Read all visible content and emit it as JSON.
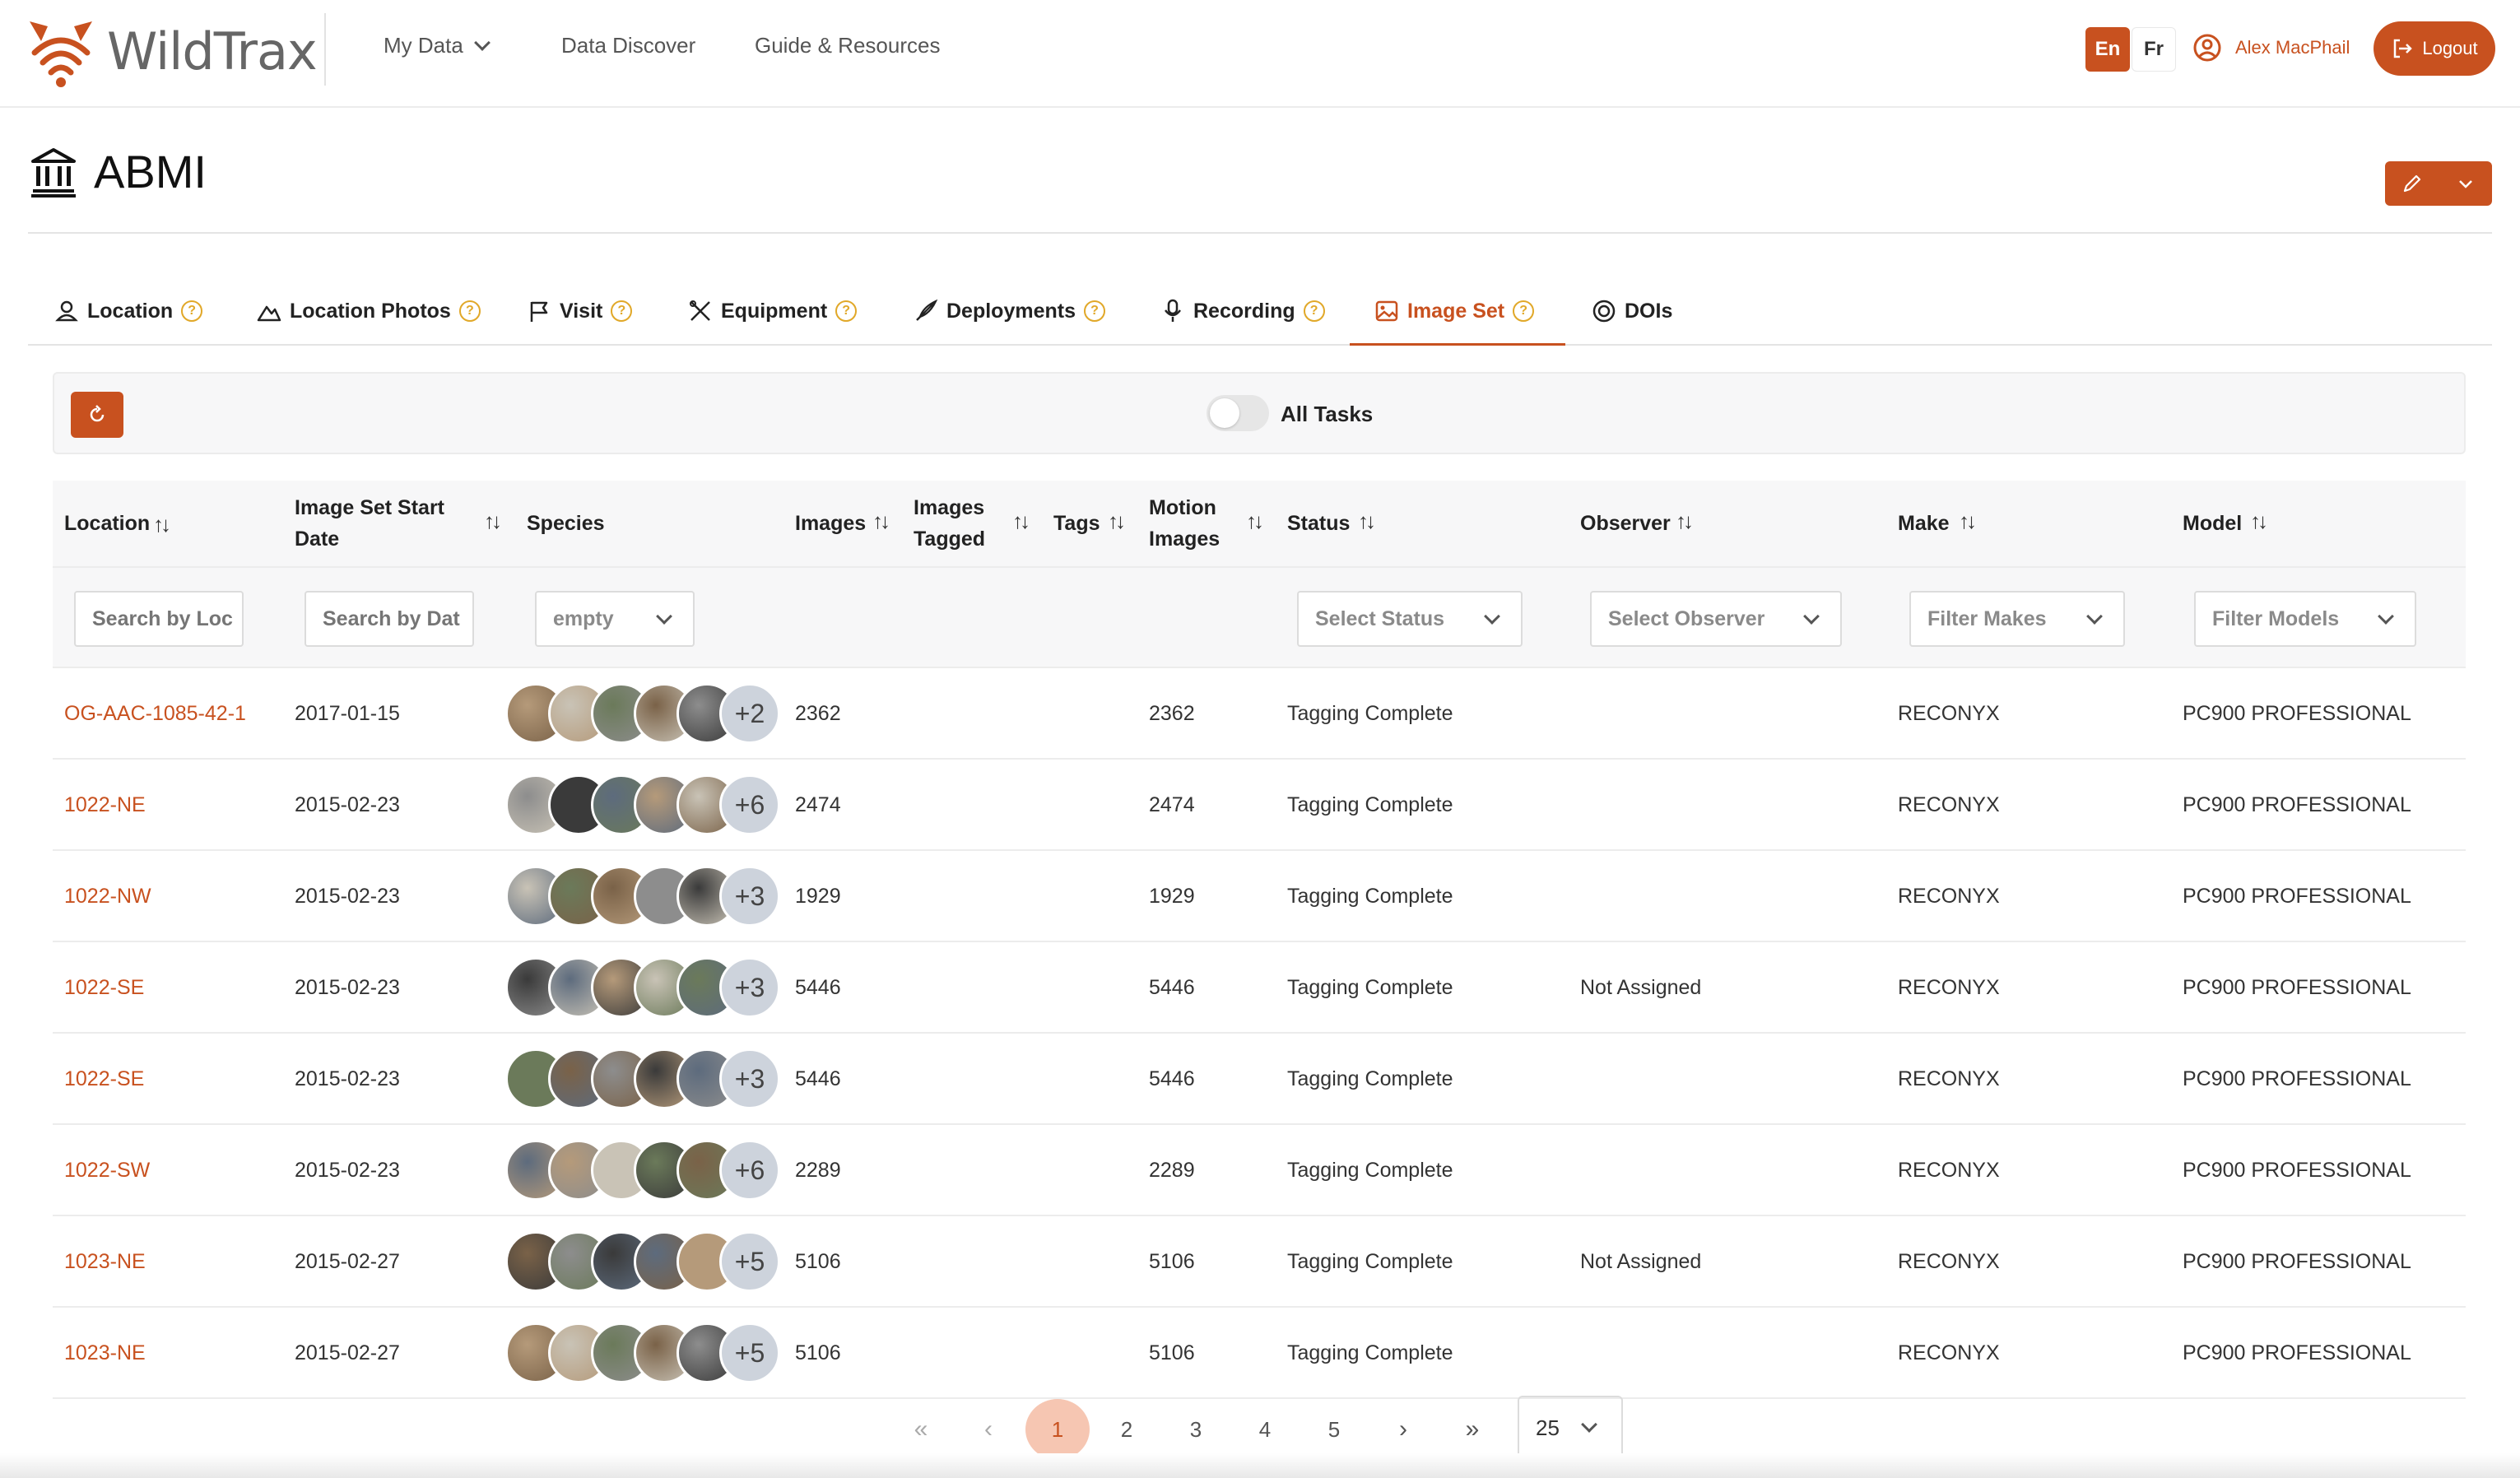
{
  "app": {
    "name": "WildTrax",
    "nav": [
      {
        "label": "My Data"
      },
      {
        "label": "Data Discover"
      },
      {
        "label": "Guide & Resources"
      }
    ],
    "lang_en": "En",
    "lang_fr": "Fr",
    "user_name": "Alex MacPhail",
    "logout_label": "Logout",
    "accent_color": "#c8511f"
  },
  "page": {
    "title": "ABMI"
  },
  "tabs": [
    {
      "label": "Location",
      "icon": "user-pin-icon",
      "help": true
    },
    {
      "label": "Location Photos",
      "icon": "mountain-icon",
      "help": true
    },
    {
      "label": "Visit",
      "icon": "flag-icon",
      "help": true
    },
    {
      "label": "Equipment",
      "icon": "tools-icon",
      "help": true
    },
    {
      "label": "Deployments",
      "icon": "rocket-icon",
      "help": true
    },
    {
      "label": "Recording",
      "icon": "microphone-icon",
      "help": true
    },
    {
      "label": "Image Set",
      "icon": "image-icon",
      "help": true,
      "active": true
    },
    {
      "label": "DOIs",
      "icon": "doi-icon",
      "help": false
    }
  ],
  "toolbar": {
    "toggle_label": "All Tasks",
    "toggle_on": false
  },
  "table": {
    "headers": {
      "location": "Location",
      "start_line1": "Image Set Start",
      "start_line2": "Date",
      "species": "Species",
      "images": "Images",
      "tagged_line1": "Images",
      "tagged_line2": "Tagged",
      "tags": "Tags",
      "motion_line1": "Motion",
      "motion_line2": "Images",
      "status": "Status",
      "observer": "Observer",
      "make": "Make",
      "model": "Model"
    },
    "filters": {
      "location": "Search by Loc",
      "date": "Search by Dat",
      "species": "empty",
      "status": "Select Status",
      "observer": "Select Observer",
      "make": "Filter Makes",
      "model": "Filter Models"
    },
    "rows": [
      {
        "location": "OG-AAC-1085-42-1",
        "date": "2017-01-15",
        "more": "+2",
        "images": "2362",
        "motion": "2362",
        "status": "Tagging Complete",
        "observer": "",
        "make": "RECONYX",
        "model": "PC900 PROFESSIONAL"
      },
      {
        "location": "1022-NE",
        "date": "2015-02-23",
        "more": "+6",
        "images": "2474",
        "motion": "2474",
        "status": "Tagging Complete",
        "observer": "",
        "make": "RECONYX",
        "model": "PC900 PROFESSIONAL"
      },
      {
        "location": "1022-NW",
        "date": "2015-02-23",
        "more": "+3",
        "images": "1929",
        "motion": "1929",
        "status": "Tagging Complete",
        "observer": "",
        "make": "RECONYX",
        "model": "PC900 PROFESSIONAL"
      },
      {
        "location": "1022-SE",
        "date": "2015-02-23",
        "more": "+3",
        "images": "5446",
        "motion": "5446",
        "status": "Tagging Complete",
        "observer": "Not Assigned",
        "make": "RECONYX",
        "model": "PC900 PROFESSIONAL"
      },
      {
        "location": "1022-SE",
        "date": "2015-02-23",
        "more": "+3",
        "images": "5446",
        "motion": "5446",
        "status": "Tagging Complete",
        "observer": "",
        "make": "RECONYX",
        "model": "PC900 PROFESSIONAL"
      },
      {
        "location": "1022-SW",
        "date": "2015-02-23",
        "more": "+6",
        "images": "2289",
        "motion": "2289",
        "status": "Tagging Complete",
        "observer": "",
        "make": "RECONYX",
        "model": "PC900 PROFESSIONAL"
      },
      {
        "location": "1023-NE",
        "date": "2015-02-27",
        "more": "+5",
        "images": "5106",
        "motion": "5106",
        "status": "Tagging Complete",
        "observer": "Not Assigned",
        "make": "RECONYX",
        "model": "PC900 PROFESSIONAL"
      },
      {
        "location": "1023-NE",
        "date": "2015-02-27",
        "more": "+5",
        "images": "5106",
        "motion": "5106",
        "status": "Tagging Complete",
        "observer": "",
        "make": "RECONYX",
        "model": "PC900 PROFESSIONAL"
      }
    ]
  },
  "pagination": {
    "first": "«",
    "prev": "‹",
    "pages": [
      "1",
      "2",
      "3",
      "4",
      "5"
    ],
    "current": "1",
    "next": "›",
    "last": "»",
    "per_page": "25"
  }
}
